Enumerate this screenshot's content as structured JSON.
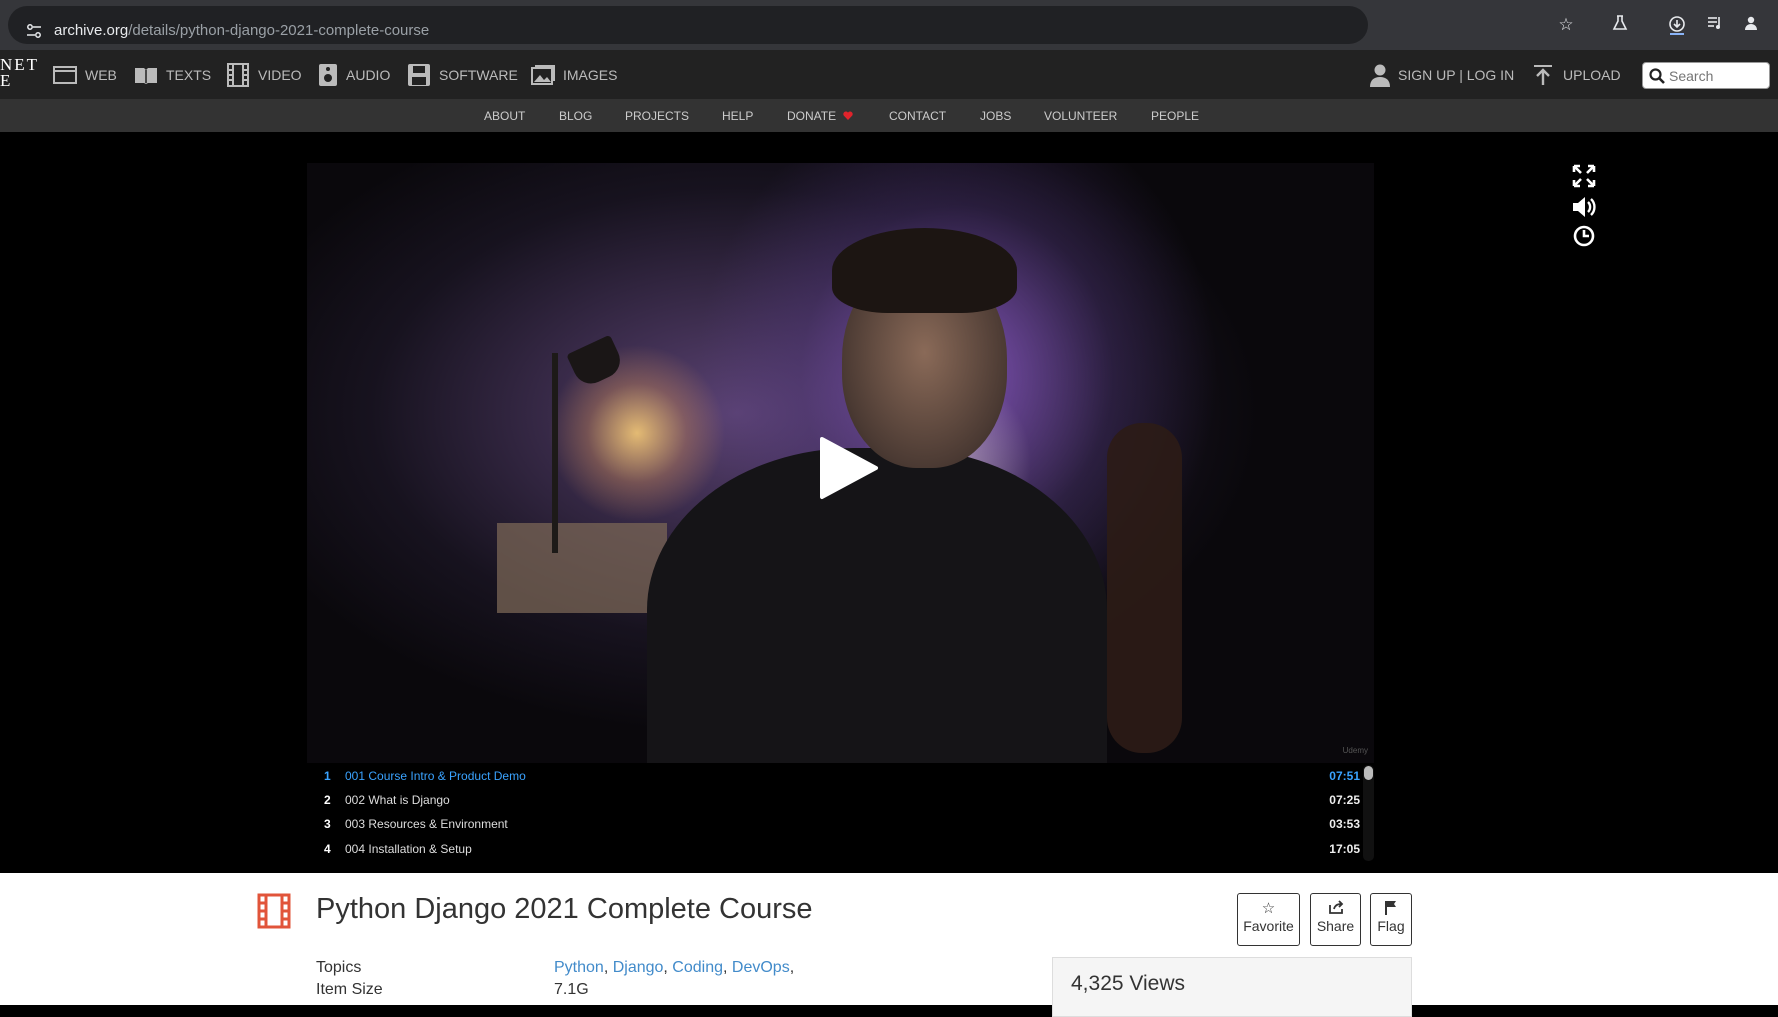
{
  "browser": {
    "url_host": "archive.org",
    "url_path": "/details/python-django-2021-complete-course"
  },
  "topnav": {
    "logo_fragment_line1": "NET",
    "logo_fragment_line2": "E",
    "media_tabs": [
      {
        "label": "WEB",
        "icon": "web-icon"
      },
      {
        "label": "TEXTS",
        "icon": "book-icon"
      },
      {
        "label": "VIDEO",
        "icon": "film-icon"
      },
      {
        "label": "AUDIO",
        "icon": "speaker-icon"
      },
      {
        "label": "SOFTWARE",
        "icon": "floppy-icon"
      },
      {
        "label": "IMAGES",
        "icon": "image-icon"
      }
    ],
    "auth_label": "SIGN UP | LOG IN",
    "upload_label": "UPLOAD",
    "search_placeholder": "Search"
  },
  "subnav": {
    "links": [
      "ABOUT",
      "BLOG",
      "PROJECTS",
      "HELP",
      "DONATE",
      "CONTACT",
      "JOBS",
      "VOLUNTEER",
      "PEOPLE"
    ]
  },
  "player": {
    "watermark": "Udemy",
    "playlist": [
      {
        "num": "1",
        "title": "001 Course Intro & Product Demo",
        "duration": "07:51",
        "active": true
      },
      {
        "num": "2",
        "title": "002 What is Django",
        "duration": "07:25",
        "active": false
      },
      {
        "num": "3",
        "title": "003 Resources & Environment",
        "duration": "03:53",
        "active": false
      },
      {
        "num": "4",
        "title": "004 Installation & Setup",
        "duration": "17:05",
        "active": false
      }
    ]
  },
  "item": {
    "title": "Python Django 2021 Complete Course",
    "actions": {
      "favorite": "Favorite",
      "share": "Share",
      "flag": "Flag"
    },
    "topics_label": "Topics",
    "topics": [
      "Python",
      "Django",
      "Coding",
      "DevOps"
    ],
    "item_size_label": "Item Size",
    "item_size": "7.1G",
    "views": "4,325 Views"
  },
  "colors": {
    "accent_link": "#428bca",
    "playlist_active": "#3aa3ff",
    "donate_heart": "#e0232b",
    "film_icon": "#e1543a"
  }
}
